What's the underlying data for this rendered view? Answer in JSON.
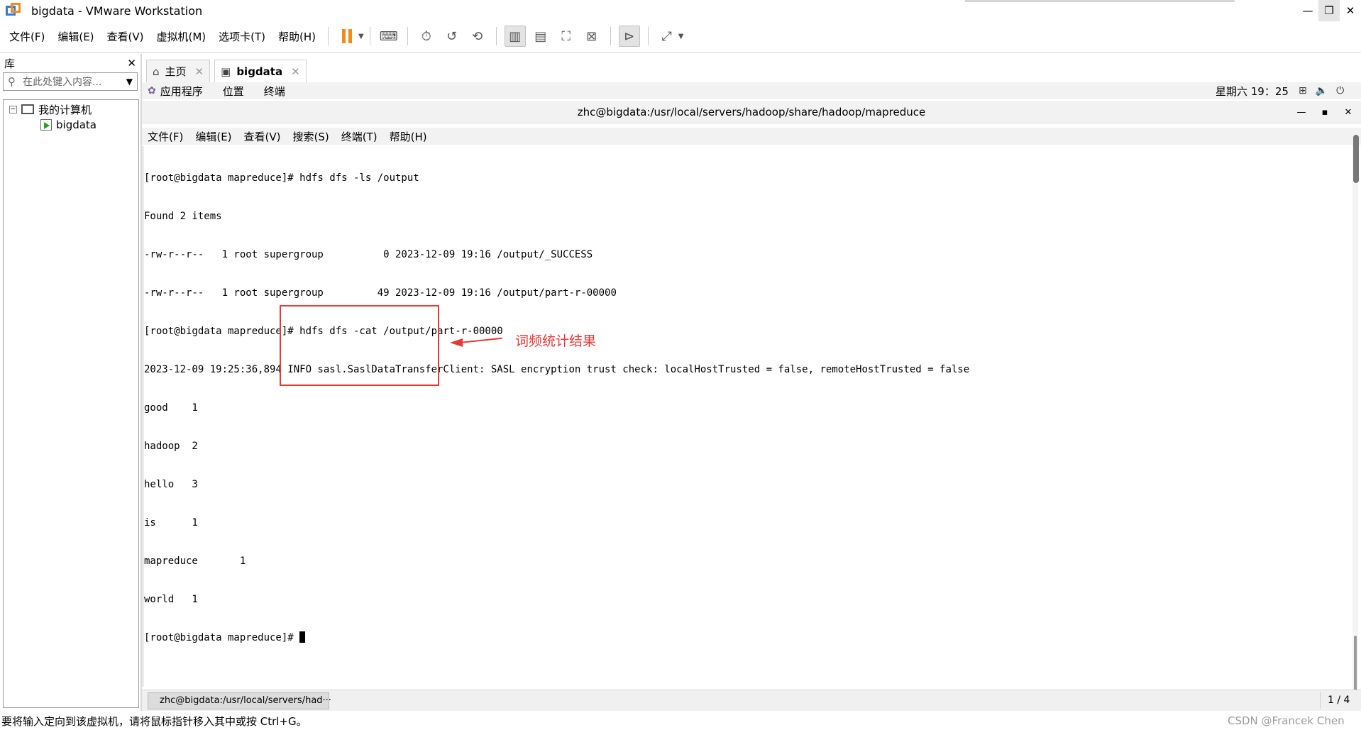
{
  "window": {
    "title": "bigdata - VMware Workstation",
    "controls": {
      "minimize": "—",
      "restore": "❐",
      "close": "✕"
    }
  },
  "menubar": {
    "items": [
      "文件(F)",
      "编辑(E)",
      "查看(V)",
      "虚拟机(M)",
      "选项卡(T)",
      "帮助(H)"
    ]
  },
  "library": {
    "title": "库",
    "close": "✕",
    "search_placeholder": "在此处键入内容...",
    "tree": {
      "root_label": "我的计算机",
      "toggle": "⊟",
      "vm_label": "bigdata"
    }
  },
  "tabs": [
    {
      "label": "主页",
      "icon": "home-icon",
      "close": "✕"
    },
    {
      "label": "bigdata",
      "icon": "vm-icon",
      "close": "✕"
    }
  ],
  "guest": {
    "topbar": {
      "menus": [
        "应用程序",
        "位置",
        "终端"
      ],
      "clock": "星期六 19：25"
    },
    "terminal": {
      "title": "zhc@bigdata:/usr/local/servers/hadoop/share/hadoop/mapreduce",
      "controls": {
        "min": "—",
        "max": "▪",
        "close": "✕"
      },
      "menu": [
        "文件(F)",
        "编辑(E)",
        "查看(V)",
        "搜索(S)",
        "终端(T)",
        "帮助(H)"
      ],
      "lines": [
        "[root@bigdata mapreduce]# hdfs dfs -ls /output",
        "Found 2 items",
        "-rw-r--r--   1 root supergroup          0 2023-12-09 19:16 /output/_SUCCESS",
        "-rw-r--r--   1 root supergroup         49 2023-12-09 19:16 /output/part-r-00000",
        "[root@bigdata mapreduce]# hdfs dfs -cat /output/part-r-00000",
        "2023-12-09 19:25:36,894 INFO sasl.SaslDataTransferClient: SASL encryption trust check: localHostTrusted = false, remoteHostTrusted = false",
        "good    1",
        "hadoop  2",
        "hello   3",
        "is      1",
        "mapreduce       1",
        "world   1"
      ],
      "prompt": "[root@bigdata mapreduce]# "
    },
    "annotation": {
      "text": "词频统计结果",
      "color": "#e53935"
    },
    "taskbar": {
      "item": "zhc@bigdata:/usr/local/servers/had···",
      "pager": "1 / 4"
    }
  },
  "statusbar": {
    "hint": "要将输入定向到该虚拟机，请将鼠标指针移入其中或按 Ctrl+G。",
    "watermark": "CSDN @Francek Chen"
  },
  "colors": {
    "accent": "#f08c1a",
    "annotation": "#e53935"
  }
}
